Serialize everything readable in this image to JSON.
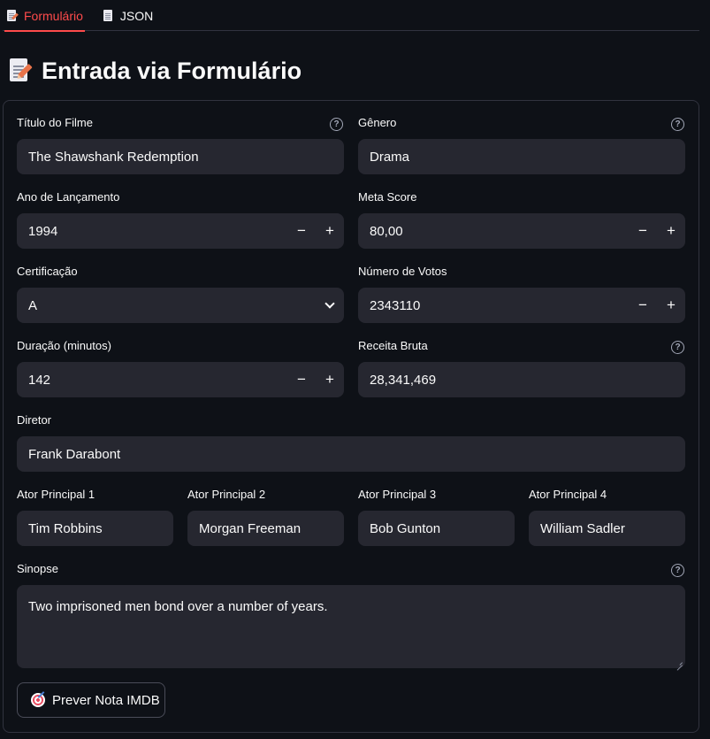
{
  "tabs": [
    {
      "label": "Formulário",
      "icon": "memo-icon",
      "active": true
    },
    {
      "label": "JSON",
      "icon": "document-icon",
      "active": false
    }
  ],
  "page": {
    "title": "Entrada via Formulário",
    "icon": "memo-icon"
  },
  "form": {
    "titulo": {
      "label": "Título do Filme",
      "value": "The Shawshank Redemption",
      "help": "?"
    },
    "genero": {
      "label": "Gênero",
      "value": "Drama",
      "help": "?"
    },
    "ano": {
      "label": "Ano de Lançamento",
      "value": "1994",
      "minus": "−",
      "plus": "+"
    },
    "meta_score": {
      "label": "Meta Score",
      "value": "80,00",
      "minus": "−",
      "plus": "+"
    },
    "certificacao": {
      "label": "Certificação",
      "value": "A"
    },
    "votos": {
      "label": "Número de Votos",
      "value": "2343110",
      "minus": "−",
      "plus": "+"
    },
    "duracao": {
      "label": "Duração (minutos)",
      "value": "142",
      "minus": "−",
      "plus": "+"
    },
    "receita": {
      "label": "Receita Bruta",
      "value": "28,341,469",
      "help": "?"
    },
    "diretor": {
      "label": "Diretor",
      "value": "Frank Darabont"
    },
    "ator1": {
      "label": "Ator Principal 1",
      "value": "Tim Robbins"
    },
    "ator2": {
      "label": "Ator Principal 2",
      "value": "Morgan Freeman"
    },
    "ator3": {
      "label": "Ator Principal 3",
      "value": "Bob Gunton"
    },
    "ator4": {
      "label": "Ator Principal 4",
      "value": "William Sadler"
    },
    "sinopse": {
      "label": "Sinopse",
      "value": "Two imprisoned men bond over a number of years.",
      "help": "?"
    },
    "submit": {
      "label": "Prever Nota IMDB",
      "icon": "target-icon"
    }
  },
  "colors": {
    "accent": "#ff4b4b",
    "background": "#0e1117",
    "input_bg": "#262730",
    "border": "#31333f"
  }
}
